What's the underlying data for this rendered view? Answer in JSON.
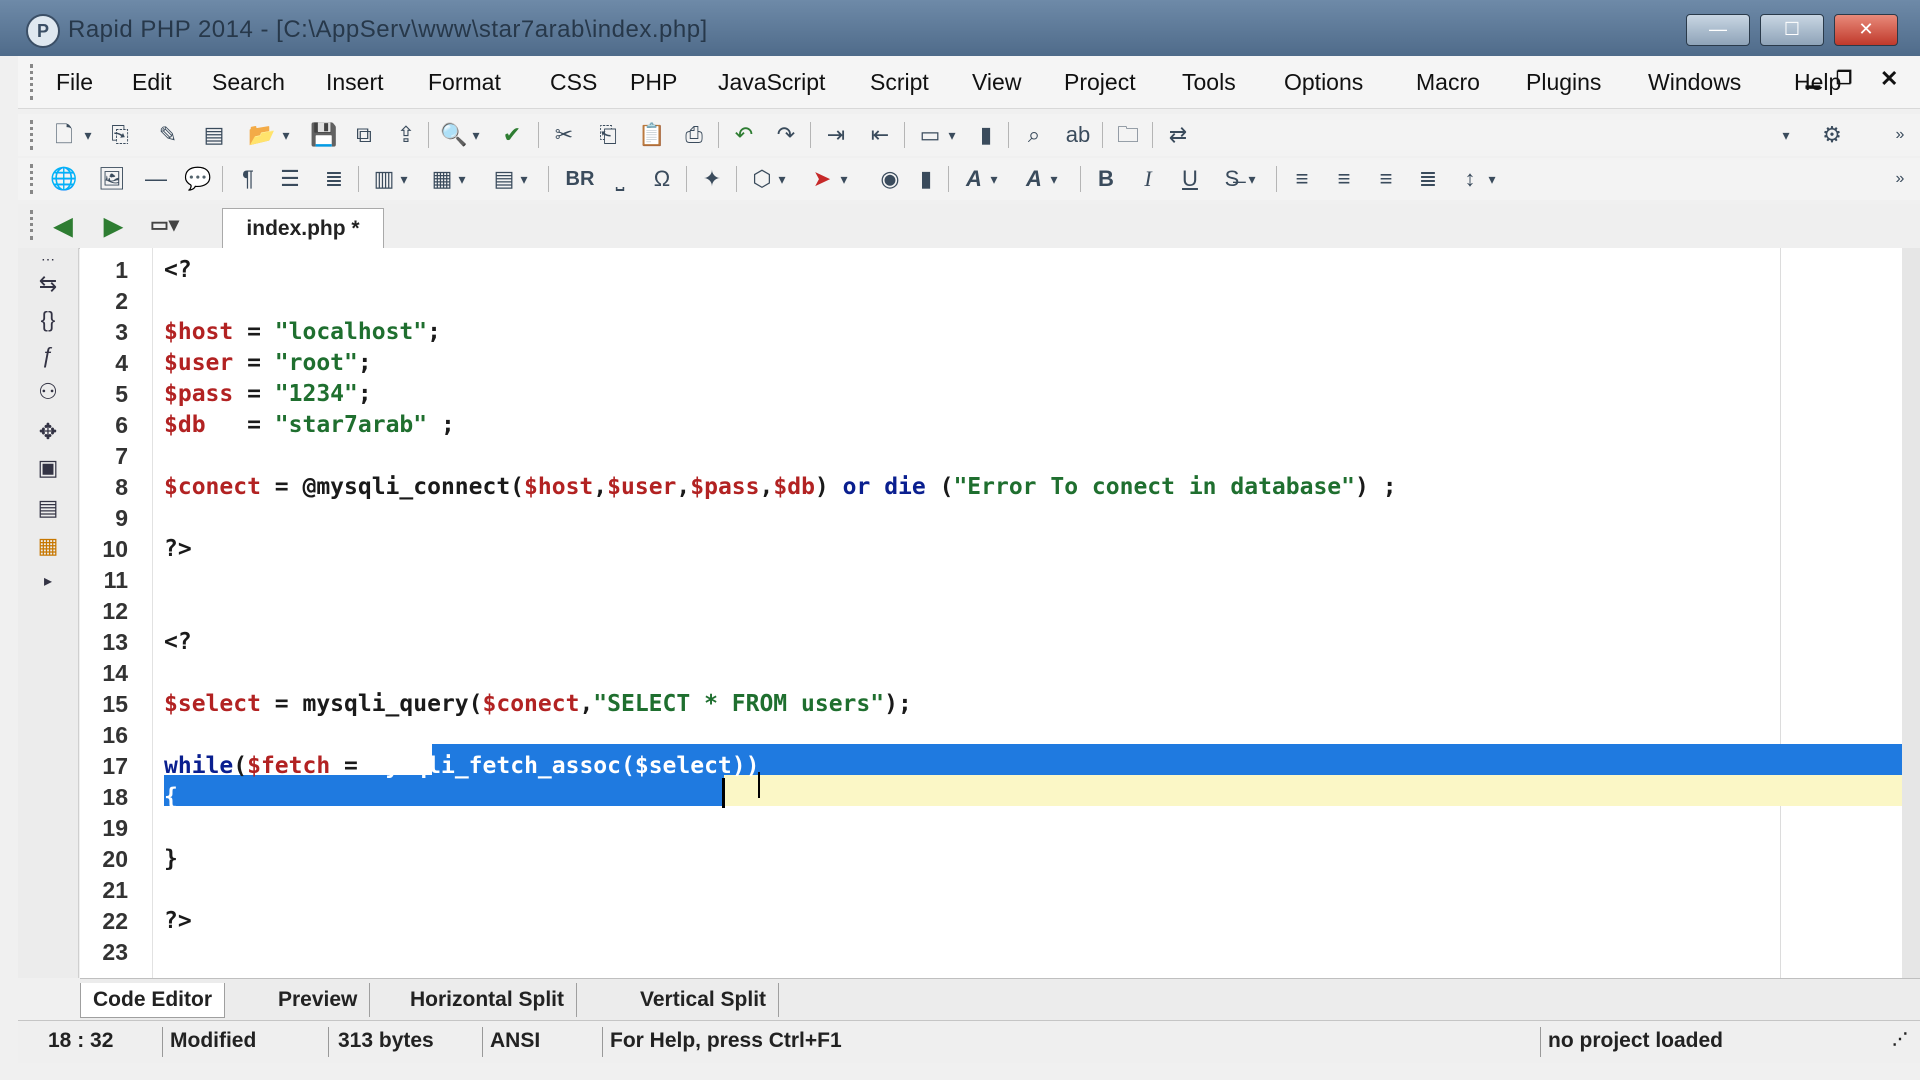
{
  "window": {
    "title": "Rapid PHP 2014 - [C:\\AppServ\\www\\star7arab\\index.php]",
    "app_icon_letter": "P",
    "controls": [
      "minimize",
      "maximize",
      "close"
    ]
  },
  "menu": [
    "File",
    "Edit",
    "Search",
    "Insert",
    "Format",
    "CSS",
    "PHP",
    "JavaScript",
    "Script",
    "View",
    "Project",
    "Tools",
    "Options",
    "Macro",
    "Plugins",
    "Windows",
    "Help"
  ],
  "toolbar": {
    "bold_label": "B",
    "italic_label": "I",
    "underline_label": "U",
    "br_label": "BR"
  },
  "document_tab": "index.php *",
  "code_lines": [
    {
      "n": "1",
      "text": "<?"
    },
    {
      "n": "2",
      "text": ""
    },
    {
      "n": "3",
      "text": "$host = \"localhost\";"
    },
    {
      "n": "4",
      "text": "$user = \"root\";"
    },
    {
      "n": "5",
      "text": "$pass = \"1234\";"
    },
    {
      "n": "6",
      "text": "$db   = \"star7arab\" ;"
    },
    {
      "n": "7",
      "text": ""
    },
    {
      "n": "8",
      "text": "$conect = @mysqli_connect($host,$user,$pass,$db) or die (\"Error To conect in database\") ;"
    },
    {
      "n": "9",
      "text": ""
    },
    {
      "n": "10",
      "text": "?>"
    },
    {
      "n": "11",
      "text": ""
    },
    {
      "n": "12",
      "text": ""
    },
    {
      "n": "13",
      "text": "<?"
    },
    {
      "n": "14",
      "text": ""
    },
    {
      "n": "15",
      "text": "$select = mysqli_query($conect,\"SELECT * FROM users\");"
    },
    {
      "n": "16",
      "text": ""
    },
    {
      "n": "17",
      "text": "while($fetch = mysqli_fetch_assoc($select))"
    },
    {
      "n": "18",
      "text": "{"
    },
    {
      "n": "19",
      "text": ""
    },
    {
      "n": "20",
      "text": "}"
    },
    {
      "n": "21",
      "text": ""
    },
    {
      "n": "22",
      "text": "?>"
    },
    {
      "n": "23",
      "text": ""
    }
  ],
  "bottom_tabs": [
    "Code Editor",
    "Preview",
    "Horizontal Split",
    "Vertical Split"
  ],
  "status": {
    "position": "18 : 32",
    "state": "Modified",
    "size": "313 bytes",
    "encoding": "ANSI",
    "help": "For Help, press Ctrl+F1",
    "project": "no project loaded"
  },
  "colors": {
    "variable": "#b22222",
    "string": "#1f6f2f",
    "keyword": "#0a1f8f",
    "selection": "#1f7ae0",
    "current_line": "#fbf7c6"
  }
}
